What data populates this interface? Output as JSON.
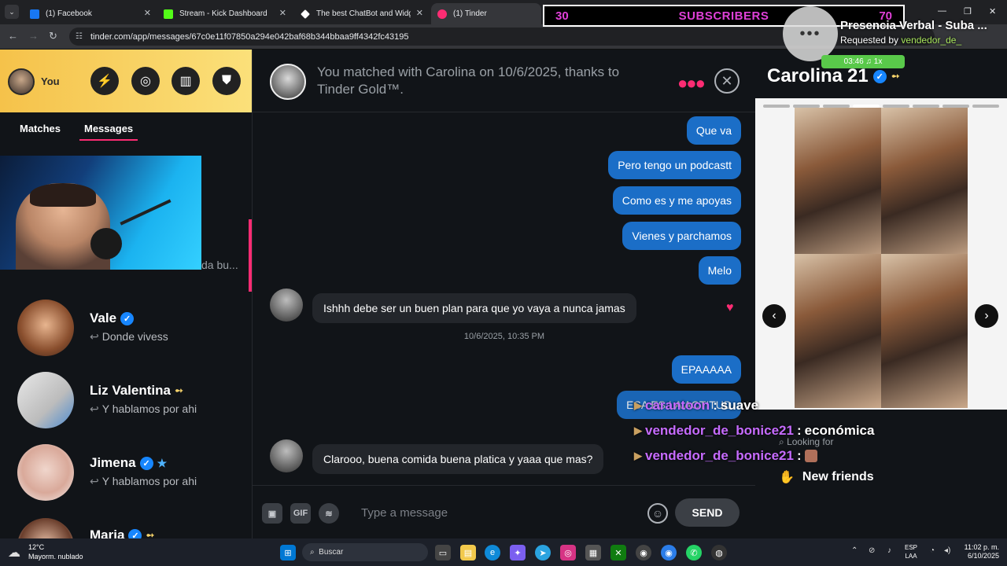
{
  "browser": {
    "tabs": [
      {
        "title": "(1) Facebook",
        "color": "#1877f2"
      },
      {
        "title": "Stream - Kick Dashboard",
        "color": "#53fc18"
      },
      {
        "title": "The best ChatBot and Widgets",
        "color": "#ffffff"
      },
      {
        "title": "(1) Tinder",
        "color": "#fd2c73"
      }
    ],
    "url": "tinder.com/app/messages/67c0e11f07850a294e042baf68b344bbaa9ff4342fc43195"
  },
  "overlay": {
    "sub_current": "30",
    "sub_title": "SUBSCRIBERS",
    "sub_goal": "70",
    "song_title": "Presencia Verbal - Suba ...",
    "requested_prefix": "Requested by",
    "requested_user": "vendedor_de_",
    "song_time": "03:46",
    "speed": "1x",
    "chat": [
      {
        "user": "carantoon",
        "text": "suave"
      },
      {
        "user": "vendedor_de_bonice21",
        "text": "económica"
      },
      {
        "user": "vendedor_de_bonice21",
        "text": ""
      }
    ]
  },
  "sidebar": {
    "user_label": "You",
    "tabs": {
      "matches": "Matches",
      "messages": "Messages"
    },
    "hidden_preview": "da bu...",
    "conversations": [
      {
        "name": "Vale",
        "message": "Donde vivess",
        "badges": [
          "verified"
        ]
      },
      {
        "name": "Liz Valentina",
        "message": "Y hablamos por ahi",
        "badges": [
          "gold"
        ]
      },
      {
        "name": "Jimena",
        "message": "Y hablamos por ahi",
        "badges": [
          "verified",
          "star"
        ]
      },
      {
        "name": "Maria",
        "message": "",
        "badges": [
          "verified",
          "gold"
        ]
      }
    ]
  },
  "chat": {
    "header": "You matched with Carolina on 10/6/2025, thanks to Tinder Gold™.",
    "messages_out_1": [
      "Que va",
      "Pero tengo un podcastt",
      "Como es y me apoyas",
      "Vienes y parchamos",
      "Melo"
    ],
    "message_in_1": "Ishhh debe ser un buen plan para que yo vaya a nunca jamas",
    "timestamp": "10/6/2025, 10:35 PM",
    "messages_out_2": [
      "EPAAAAA",
      "ESA ES LA ACTITUD"
    ],
    "message_in_2": "Clarooo, buena comida buena platica y yaaa que mas?",
    "input_placeholder": "Type a message",
    "gif_label": "GIF",
    "send_label": "SEND"
  },
  "profile": {
    "name": "Carolina",
    "age": "21",
    "looking_for_label": "Looking for",
    "looking_for_value": "New friends"
  },
  "taskbar": {
    "temp": "12°C",
    "weather": "Mayorm. nublado",
    "search": "Buscar",
    "lang_1": "ESP",
    "lang_2": "LAA",
    "time": "11:02 p. m.",
    "date": "6/10/2025"
  }
}
